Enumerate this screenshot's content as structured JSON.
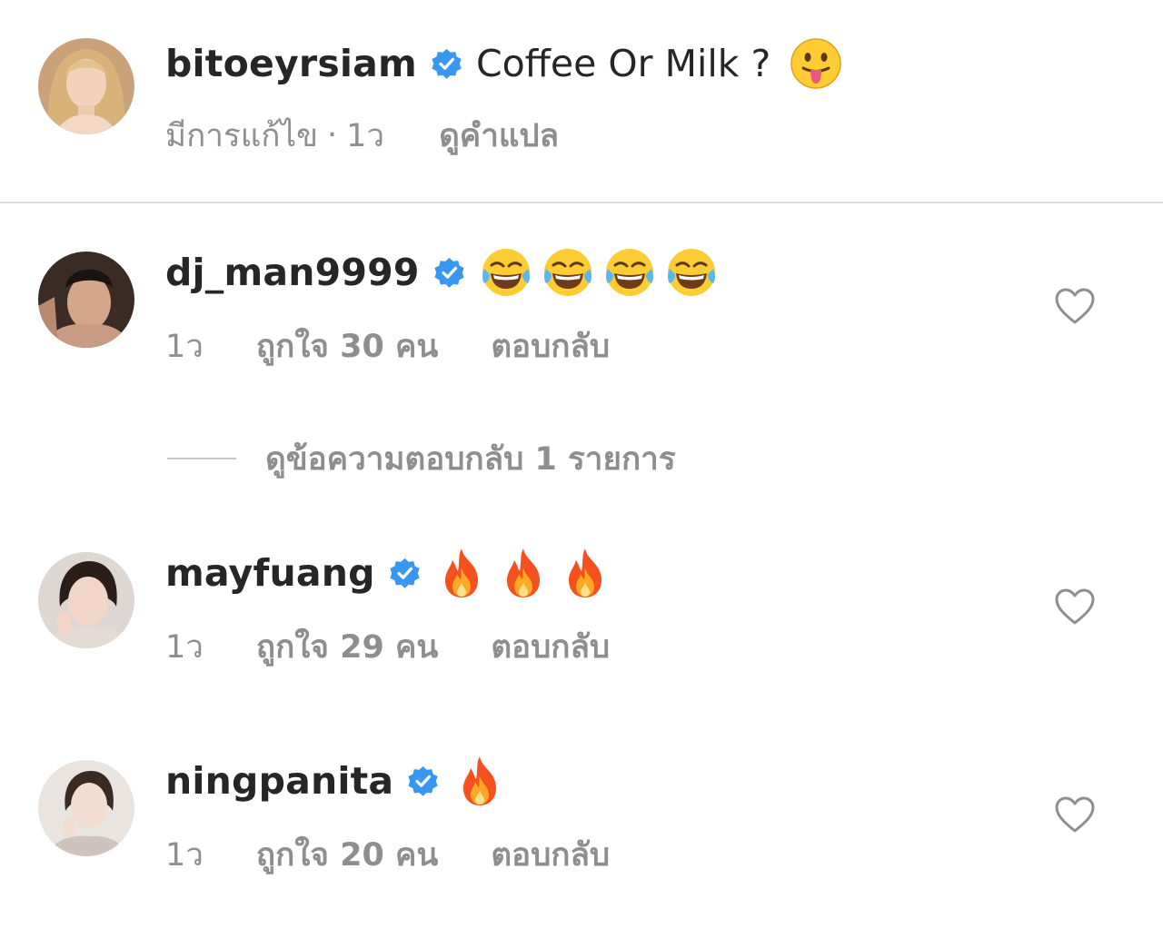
{
  "caption": {
    "username": "bitoeyrsiam",
    "text": "Coffee Or Milk ?",
    "emojis": [
      "face-with-tongue-emoji"
    ],
    "edited_label": "มีการแก้ไข",
    "separator": "·",
    "time": "1ว",
    "translate_label": "ดูคำแปล"
  },
  "comments": [
    {
      "username": "dj_man9999",
      "emojis": [
        "tears-of-joy-emoji",
        "tears-of-joy-emoji",
        "tears-of-joy-emoji",
        "tears-of-joy-emoji"
      ],
      "time": "1ว",
      "likes_label": "ถูกใจ 30 คน",
      "reply_label": "ตอบกลับ"
    },
    {
      "username": "mayfuang",
      "emojis": [
        "fire-emoji",
        "fire-emoji",
        "fire-emoji"
      ],
      "time": "1ว",
      "likes_label": "ถูกใจ 29 คน",
      "reply_label": "ตอบกลับ"
    },
    {
      "username": "ningpanita",
      "emojis": [
        "fire-emoji"
      ],
      "time": "1ว",
      "likes_label": "ถูกใจ 20 คน",
      "reply_label": "ตอบกลับ"
    }
  ],
  "view_replies_label": "ดูข้อความตอบกลับ 1 รายการ",
  "colors": {
    "text": "#262626",
    "secondary": "#8e8e8e",
    "verified": "#3897f0",
    "divider": "#dbdbdb"
  }
}
